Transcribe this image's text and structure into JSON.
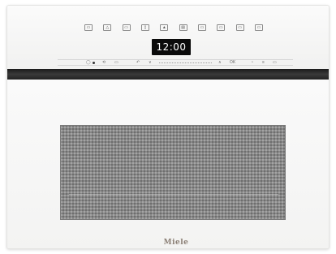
{
  "appliance": {
    "type": "built-in oven",
    "body_color": "#f7f7f6",
    "accent_dark": "#1a1a1a"
  },
  "control_panel": {
    "program_buttons": [
      {
        "icon": "program-1-icon",
        "glyph": "▭"
      },
      {
        "icon": "program-2-icon",
        "glyph": "△"
      },
      {
        "icon": "program-3-icon",
        "glyph": "▭"
      },
      {
        "icon": "program-4-icon",
        "glyph": "▯"
      },
      {
        "icon": "program-5-icon",
        "glyph": "▲"
      },
      {
        "icon": "program-6-icon",
        "glyph": "▤"
      },
      {
        "icon": "program-7-icon",
        "glyph": "▭"
      },
      {
        "icon": "program-8-icon",
        "glyph": "▭"
      },
      {
        "icon": "program-9-icon",
        "glyph": "▭"
      },
      {
        "icon": "program-10-icon",
        "glyph": "▭"
      }
    ],
    "display": {
      "time": "12:00"
    },
    "strip_icons": {
      "power": "◯",
      "light": "⟲",
      "back": "↶",
      "down": "∨",
      "up": "∧",
      "ok": "OK",
      "timer": "◔",
      "menu": "≡",
      "extra": "▭"
    }
  },
  "door": {
    "brand": "Miele"
  }
}
